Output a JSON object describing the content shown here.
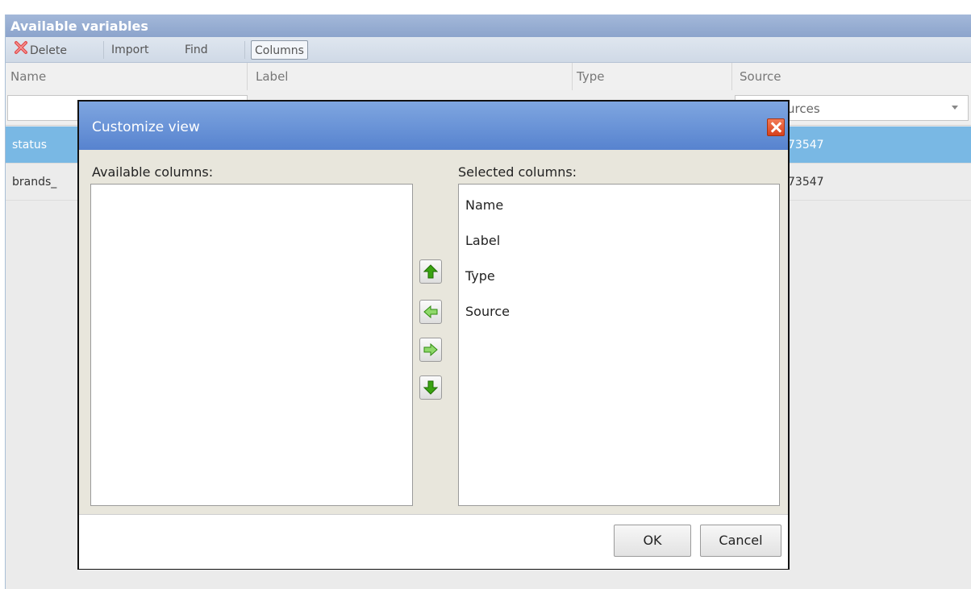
{
  "panel": {
    "title": "Available variables"
  },
  "toolbar": {
    "delete_label": "Delete",
    "import_label": "Import",
    "find_label": "Find",
    "columns_label": "Columns"
  },
  "grid": {
    "columns": [
      "Name",
      "Label",
      "Type",
      "Source"
    ],
    "source_filter": "urces",
    "rows": [
      {
        "name": "status",
        "source": "73547",
        "selected": true
      },
      {
        "name": "brands_",
        "source": "73547",
        "selected": false
      }
    ]
  },
  "dialog": {
    "title": "Customize view",
    "available_label": "Available columns:",
    "selected_label": "Selected columns:",
    "available_columns": [],
    "selected_columns": [
      "Name",
      "Label",
      "Type",
      "Source"
    ],
    "ok_label": "OK",
    "cancel_label": "Cancel"
  },
  "colors": {
    "header_blue": "#8ca4cc",
    "selected_row": "#79b8e4",
    "dialog_title": "#5783cf",
    "close_red": "#d8401c",
    "arrow_green": "#3aa312"
  },
  "icons": [
    "delete-x-icon",
    "close-icon",
    "move-up-icon",
    "move-left-icon",
    "move-right-icon",
    "move-down-icon",
    "dropdown-arrow-icon"
  ]
}
